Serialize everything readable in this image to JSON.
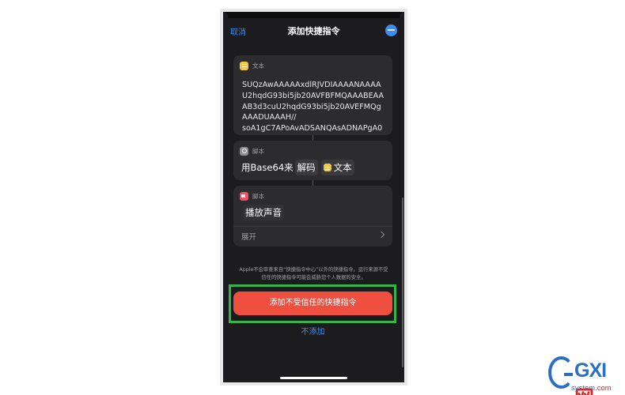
{
  "nav": {
    "cancel": "取消",
    "title": "添加快捷指令",
    "more_icon": "ellipsis-circle-icon"
  },
  "actions": [
    {
      "type": "文本",
      "icon": "text-app-icon",
      "body_lines": [
        "SUQzAwAAAAAxdlRJVDIAAAANAAAA",
        "U2hqdG93bi5jb20AVFBFMQAAABEAA",
        "AB3d3cuU2hqdG93bi5jb20AVEFMQg",
        "AAADUAAAH//",
        "soA1gC7APoAvADSANQAsADNAPgA0"
      ]
    },
    {
      "type": "脚本",
      "icon": "script-gear-icon",
      "prefix": "用Base64来",
      "operation": "解码",
      "variable": "文本"
    },
    {
      "type": "脚本",
      "icon": "sound-icon",
      "title": "播放声音",
      "expand": "展开"
    }
  ],
  "warning": "Apple不会审查来自“快捷指令中心”以外的快捷指令。运行来源不受信任的快捷指令可能会威胁您个人数据的安全。",
  "primary_button": "添加不受信任的快捷指令",
  "secondary_button": "不添加",
  "colors": {
    "accent": "#3d8cf5",
    "danger": "#ef4f3f",
    "highlight": "#37b24d",
    "card": "#2c2c2e",
    "background": "#1c1c1e"
  },
  "watermark": {
    "letters": "GXI",
    "char": "网",
    "domain_a": "system",
    "domain_b": ".com"
  }
}
